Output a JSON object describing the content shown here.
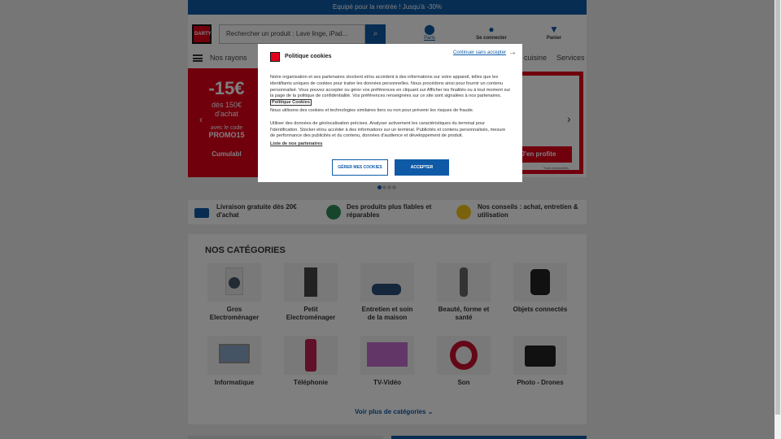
{
  "topbar": {
    "promo": "Equipé pour la rentrée ! Jusqu'à -30%"
  },
  "header": {
    "logo_text": "DARTY",
    "search_placeholder": "Rechercher un produit : Lave linge, iPad...",
    "store_label": "Paris",
    "account_label": "Se connecter",
    "cart_label": "Panier"
  },
  "nav": {
    "menu_label": "Nos rayons",
    "item_cuisine": "cuisine",
    "item_services": "Services"
  },
  "hero": {
    "discount": "-15€",
    "subtitle": "dès 150€ d'achat",
    "code_label": "avec le code",
    "code": "PROMO15",
    "cumulable": "Cumulabl",
    "cta": "J'en profite",
    "footnote": "*hors exclusivités"
  },
  "perks": [
    {
      "label": "Livraison gratuite dès 20€ d'achat"
    },
    {
      "label": "Des produits plus fiables et réparables"
    },
    {
      "label": "Nos conseils : achat, entretien & utilisation"
    }
  ],
  "categories": {
    "title": "NOS CATÉGORIES",
    "items": [
      "Gros Electroménager",
      "Petit Electroménager",
      "Entretien et soin de la maison",
      "Beauté, forme et santé",
      "Objets connectés",
      "Informatique",
      "Téléphonie",
      "TV-Vidéo",
      "Son",
      "Photo - Drones"
    ],
    "more_label": "Voir plus de catégories"
  },
  "cookie_modal": {
    "title": "Politique cookies",
    "continue_label": "Continuer sans accepter",
    "para1_a": "Notre organisation et ses partenaires stockent et/ou accèdent à des informations sur votre appareil, telles que les identifiants uniques de cookies pour traiter les données personnelles. Nous procédons ainsi pour fournir un contenu personnalisé. Vous pouvez accepter ou gérer vos préférences en cliquant sur Afficher les finalités ou à tout moment sur la page de la politique de confidentialité. Vos préférences renseignées sur ce site sont signalées à nos partenaires.",
    "policy_link": "Politique Cookies",
    "para2": "Nous utilisons des cookies et technologies similaires tiers ou non pour prévenir les risques de fraude.",
    "para3": "Utiliser des données de géolocalisation précises. Analyser activement les caractéristiques du terminal pour l'identification. Stocker et/ou accéder à des informations sur un terminal. Publicités et contenu personnalisés, mesure de performance des publicités et du contenu, données d'audience et développement de produit.",
    "partners_link": "Liste de nos partenaires",
    "manage_label": "GÉRER MES COOKIES",
    "accept_label": "ACCEPTER"
  },
  "colors": {
    "brand_blue": "#0f5aa7",
    "brand_red": "#e2001a"
  }
}
